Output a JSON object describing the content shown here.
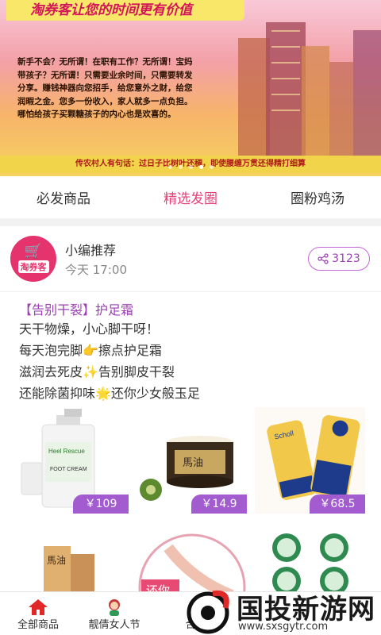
{
  "banner": {
    "title": "淘券客让您的时间更有价值",
    "lines": [
      "新手不会？无所谓！在职有工作？无所谓！宝妈",
      "带孩子？无所谓！只需要业余时间，只需要转发",
      "分享。赚钱神器向您招手，给您意外之财，给您",
      "润暇之金。您多一份收入，家人就多一点负担。",
      "哪怕给孩子买颗糖孩子的内心也是欢喜的。"
    ],
    "footer": "传农村人有句话：过日子比树叶还稠，即使腰缠万贯还得精打细算"
  },
  "tabs": [
    {
      "label": "必发商品"
    },
    {
      "label": "精选发圈"
    },
    {
      "label": "圈粉鸡汤"
    }
  ],
  "post": {
    "avatar_label": "淘券客",
    "author": "小编推荐",
    "time": "今天 17:00",
    "share_count": "3123",
    "title": "【告别干裂】护足霜",
    "lines": [
      "天干物燥，小心脚干呀！",
      "每天泡完脚👉擦点护足霜",
      "滋润去死皮✨告别脚皮干裂",
      "还能除菌抑味🌟还你少女般玉足"
    ],
    "products": [
      {
        "price": "￥109",
        "label_text": "Heel Rescue",
        "sub_text": "FOOT CREAM"
      },
      {
        "price": "￥14.9",
        "label_text": "馬油"
      },
      {
        "price": "￥68.5",
        "label_text": "Scholl"
      }
    ],
    "row2_labels": [
      "馬油",
      "还你"
    ]
  },
  "bottom_nav": [
    {
      "label": "全部商品",
      "icon": "home-icon"
    },
    {
      "label": "靓倩女人节",
      "icon": "girl-icon"
    },
    {
      "label": "合",
      "icon": "combine-icon"
    }
  ],
  "watermark": {
    "text": "国投新游网",
    "url": "www.sxsgytr.com"
  },
  "colors": {
    "accent": "#e8407a",
    "purple": "#a35bd0",
    "share_border": "#c566d8"
  }
}
